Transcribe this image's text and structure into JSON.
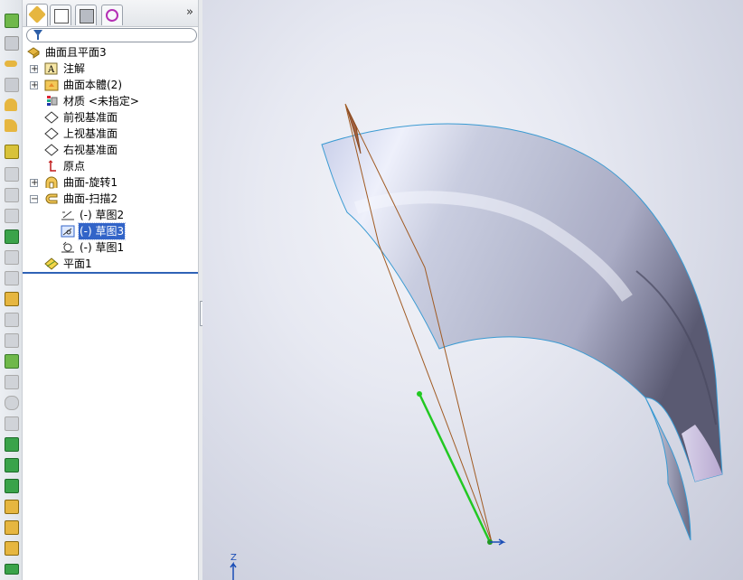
{
  "app": "SolidWorks",
  "feature_manager": {
    "tabs": [
      {
        "name": "feature-manager-tab",
        "active": true
      },
      {
        "name": "property-manager-tab",
        "active": false
      },
      {
        "name": "configuration-manager-tab",
        "active": false
      },
      {
        "name": "dimxpert-tab",
        "active": false
      }
    ],
    "more_symbol": "»",
    "filter_placeholder": "",
    "tree": {
      "root": "曲面且平面3",
      "annotations": "注解",
      "surface_bodies": "曲面本體(2)",
      "material": "材质 <未指定>",
      "front_plane": "前视基准面",
      "top_plane": "上视基准面",
      "right_plane": "右视基准面",
      "origin": "原点",
      "surface_revolve": "曲面-旋转1",
      "surface_sweep": "曲面-扫描2",
      "sketch2": "(-) 草图2",
      "sketch3": "(-) 草图3",
      "sketch1": "(-) 草图1",
      "plane1": "平面1"
    }
  },
  "graphics": {
    "view_triad_label": "Z"
  },
  "colors": {
    "selection": "#3264c8",
    "rollback_bar": "#2f62b6",
    "surface_edge": "#3a9ad2",
    "sketch_line": "#a05a22",
    "selected_sketch": "#22c822"
  }
}
